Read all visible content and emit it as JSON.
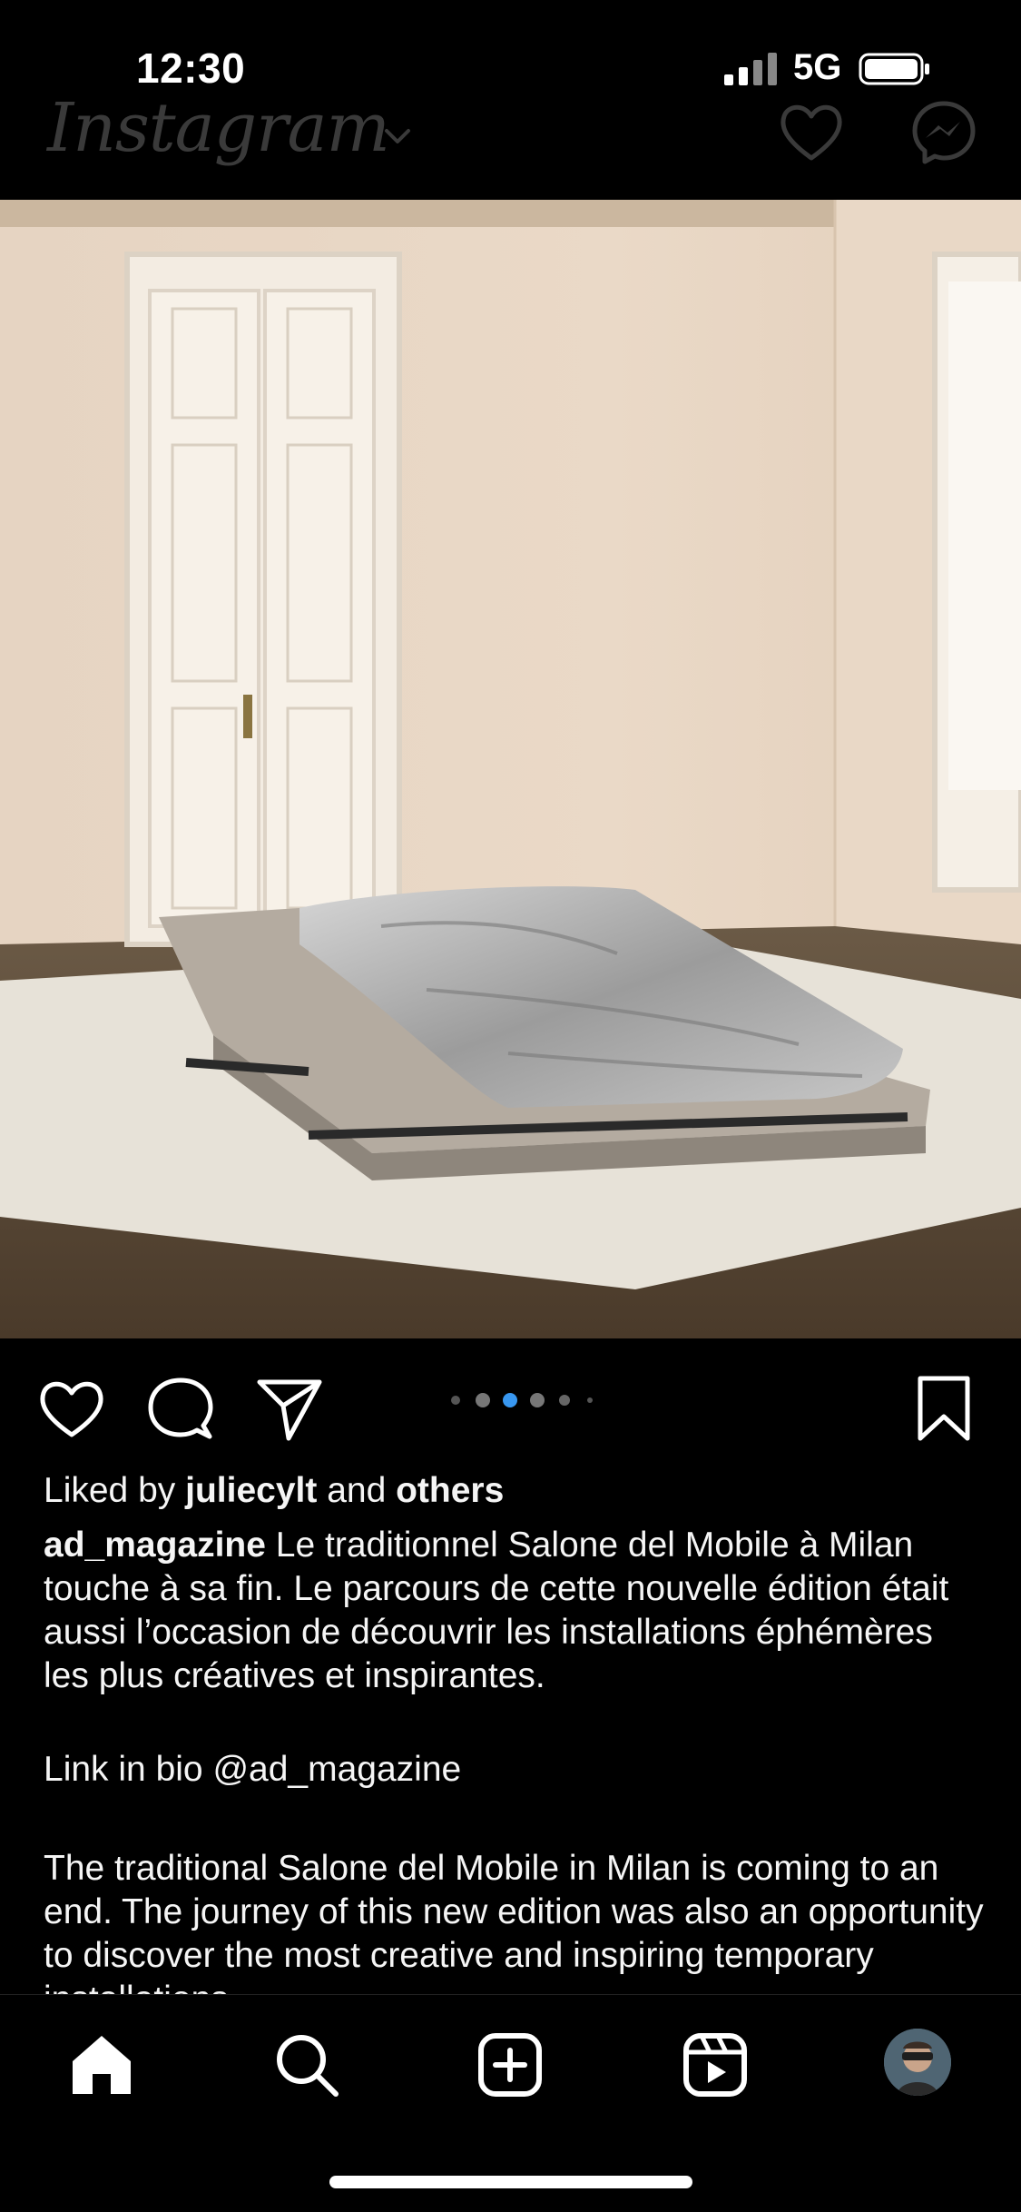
{
  "status_bar": {
    "time": "12:30",
    "network": "5G"
  },
  "header": {
    "logo": "Instagram",
    "icons": [
      "chevron-down-icon",
      "heart-icon",
      "messenger-icon"
    ]
  },
  "post": {
    "carousel": {
      "total": 6,
      "active_index": 2
    },
    "actions": [
      "heart-icon",
      "comment-icon",
      "share-icon",
      "bookmark-icon"
    ],
    "likes": {
      "prefix": "Liked by",
      "user": "juliecylt",
      "joiner": "and",
      "others": "others"
    },
    "caption": {
      "username": "ad_magazine",
      "text": "Le traditionnel Salone del Mobile à Milan touche à sa fin. Le parcours de cette nouvelle édition était aussi l’occasion de découvrir les installations éphémères les plus créatives et inspirantes.",
      "bio_link": "Link in bio @ad_magazine",
      "english": "The traditional Salone del Mobile in Milan is coming to an end. The journey of this new edition was also an opportunity to discover the most creative and inspiring temporary installations."
    }
  },
  "tab_bar": {
    "tabs": [
      "home-icon",
      "search-icon",
      "create-icon",
      "reels-icon",
      "profile-avatar"
    ],
    "active": "home"
  },
  "colors": {
    "background": "#000000",
    "active_dot": "#3897f0",
    "text": "#f5f5f5"
  }
}
